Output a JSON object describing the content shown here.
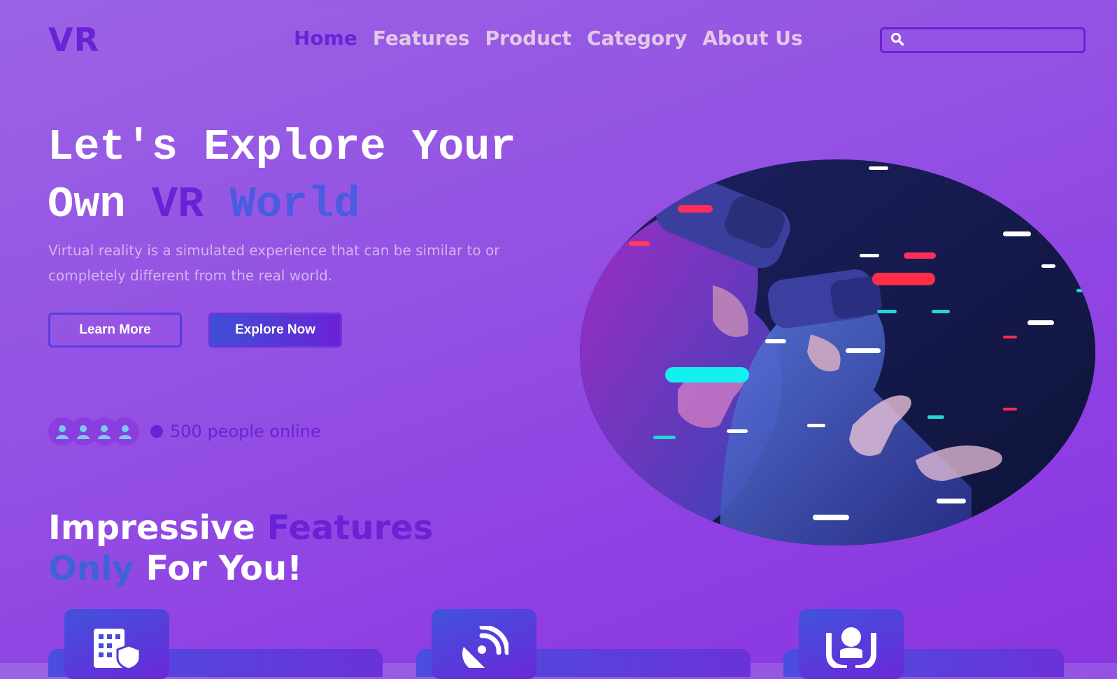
{
  "brand": {
    "logo": "VR"
  },
  "nav": {
    "items": [
      {
        "label": "Home",
        "active": true
      },
      {
        "label": "Features",
        "active": false
      },
      {
        "label": "Product",
        "active": false
      },
      {
        "label": "Category",
        "active": false
      },
      {
        "label": "About Us",
        "active": false
      }
    ]
  },
  "search": {
    "value": "",
    "placeholder": "",
    "icon": "search-icon"
  },
  "hero": {
    "title_line1": "Let's Explore Your",
    "title_own": "Own",
    "title_vr": "VR",
    "title_world": "World",
    "description": "Virtual reality is a simulated experience that can be similar to or completely different from the real world.",
    "learn_more": "Learn More",
    "explore_now": "Explore Now",
    "online_text": "500 people online",
    "image": "Two people wearing VR headsets reaching out toward glowing neon light streaks"
  },
  "features": {
    "title_impressive": "Impressive",
    "title_features": "Features",
    "title_only": "Only",
    "title_for_you": "For You!",
    "cards": [
      {
        "icon": "building-shield-icon"
      },
      {
        "icon": "satellite-dish-icon"
      },
      {
        "icon": "hands-holding-person-icon"
      }
    ]
  },
  "colors": {
    "accent_purple": "#6a22d6",
    "accent_blue": "#3f62d8",
    "nav_text": "#e3c9e8",
    "background": "#9452e3"
  }
}
